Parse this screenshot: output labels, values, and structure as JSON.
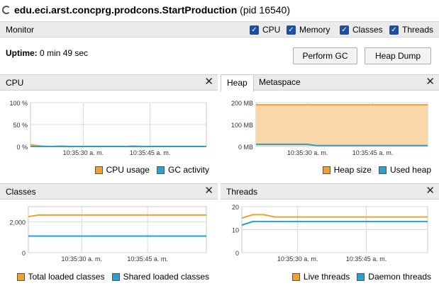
{
  "window": {
    "title": "edu.eci.arst.concprg.prodcons.StartProduction",
    "pid": "(pid 16540)"
  },
  "monitor": {
    "label": "Monitor",
    "checkboxes": [
      {
        "label": "CPU",
        "checked": true
      },
      {
        "label": "Memory",
        "checked": true
      },
      {
        "label": "Classes",
        "checked": true
      },
      {
        "label": "Threads",
        "checked": true
      }
    ]
  },
  "uptime": {
    "label": "Uptime:",
    "value": "0 min 49 sec"
  },
  "buttons": {
    "perform_gc": "Perform GC",
    "heap_dump": "Heap Dump"
  },
  "colors": {
    "orange": "#f0a030",
    "blue": "#2aa0d0",
    "heap_fill": "#fad7a8",
    "grid": "#d9d9d9"
  },
  "panels": {
    "cpu": {
      "title": "CPU",
      "legend": [
        "CPU usage",
        "GC activity"
      ]
    },
    "heap": {
      "tabs": [
        "Heap",
        "Metaspace"
      ],
      "legend": [
        "Heap size",
        "Used heap"
      ]
    },
    "classes": {
      "title": "Classes",
      "legend": [
        "Total loaded classes",
        "Shared loaded classes"
      ]
    },
    "threads": {
      "title": "Threads",
      "legend": [
        "Live threads",
        "Daemon threads"
      ]
    }
  },
  "chart_data": [
    {
      "type": "line",
      "name": "cpu",
      "yticks": [
        "100 %",
        "50 %",
        "0 %"
      ],
      "ylim": [
        0,
        100
      ],
      "xticks": [
        "10:35:30 a. m.",
        "10:35:45 a. m."
      ],
      "series": [
        {
          "name": "CPU usage",
          "values": [
            4,
            1,
            0,
            1,
            0,
            0,
            0,
            0,
            0,
            0,
            1,
            0,
            0,
            0,
            0,
            0,
            0,
            0
          ]
        },
        {
          "name": "GC activity",
          "values": [
            0,
            0,
            0,
            0,
            0,
            0,
            0,
            0,
            0,
            0,
            0,
            0,
            0,
            0,
            0,
            0,
            0,
            0
          ]
        }
      ]
    },
    {
      "type": "area",
      "name": "heap",
      "yticks": [
        "200 MB",
        "100 MB",
        "0 MB"
      ],
      "ylim": [
        0,
        200
      ],
      "xticks": [
        "10:35:30 a. m.",
        "10:35:45 a. m."
      ],
      "series": [
        {
          "name": "Heap size",
          "values": [
            190,
            190,
            190,
            190,
            190,
            190,
            190,
            190,
            190,
            190,
            190,
            190,
            190,
            190,
            190,
            190,
            190,
            190
          ]
        },
        {
          "name": "Used heap",
          "values": [
            10,
            10,
            10,
            10,
            10,
            10,
            4,
            4,
            4,
            4,
            4,
            4,
            4,
            4,
            4,
            4,
            4,
            4
          ]
        }
      ]
    },
    {
      "type": "line",
      "name": "classes",
      "yticks": [
        "2,000",
        "0"
      ],
      "ylim": [
        0,
        3000
      ],
      "xticks": [
        "10:35:30 a. m.",
        "10:35:45 a. m."
      ],
      "series": [
        {
          "name": "Total loaded classes",
          "values": [
            2350,
            2450,
            2450,
            2450,
            2450,
            2450,
            2450,
            2450,
            2450,
            2450,
            2450,
            2450,
            2450,
            2450,
            2450,
            2450,
            2450,
            2450
          ]
        },
        {
          "name": "Shared loaded classes",
          "values": [
            1080,
            1080,
            1080,
            1080,
            1080,
            1080,
            1080,
            1080,
            1080,
            1080,
            1080,
            1080,
            1080,
            1080,
            1080,
            1080,
            1080,
            1080
          ]
        }
      ]
    },
    {
      "type": "line",
      "name": "threads",
      "yticks": [
        "20",
        "10",
        "0"
      ],
      "ylim": [
        0,
        20
      ],
      "xticks": [
        "10:35:30 a. m.",
        "10:35:45 a. m."
      ],
      "series": [
        {
          "name": "Live threads",
          "values": [
            15,
            16.5,
            16.5,
            15.5,
            15.5,
            15.5,
            15.5,
            15.5,
            15.5,
            15.5,
            15.5,
            15.5,
            15.5,
            15.5,
            15.5,
            15.5,
            15.5,
            15.5
          ]
        },
        {
          "name": "Daemon threads",
          "values": [
            12,
            13.5,
            13.5,
            13.5,
            13.5,
            13.5,
            13.5,
            13.5,
            13.5,
            13.5,
            13.5,
            13.5,
            13.5,
            13.5,
            13.5,
            13.5,
            13.5,
            13.5
          ]
        }
      ]
    }
  ]
}
